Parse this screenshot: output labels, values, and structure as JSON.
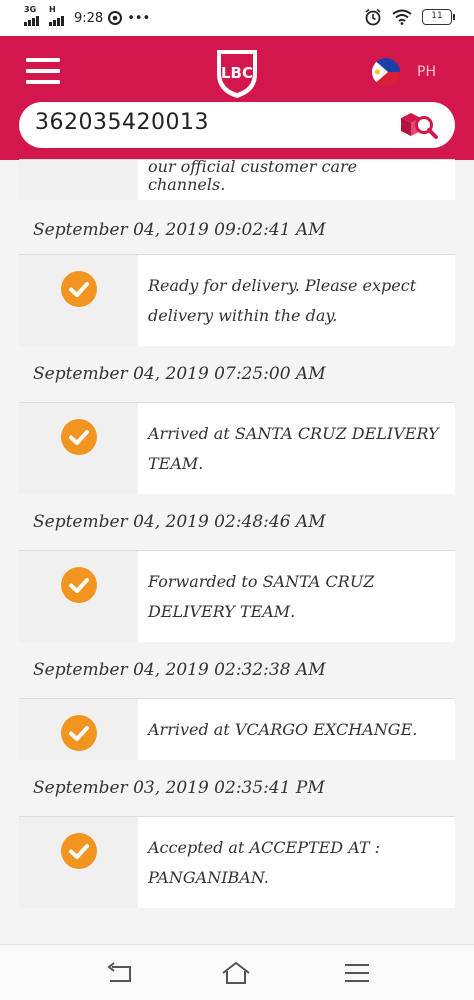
{
  "status_bar": {
    "network_top": "3G",
    "network_second": "H",
    "time": "9:28",
    "more": "•••",
    "battery": "11"
  },
  "header": {
    "logo_text": "LBC",
    "country_code": "PH",
    "brand_color": "#d3174d"
  },
  "search": {
    "value": "362035420013",
    "icon": "package-search-icon"
  },
  "timeline": {
    "partial_event_text": "our official customer care channels.",
    "entries": [
      {
        "date": "September 04, 2019 09:02:41 AM",
        "status": "Ready for delivery. Please expect delivery within the day."
      },
      {
        "date": "September 04, 2019 07:25:00 AM",
        "status": "Arrived at SANTA CRUZ DELIVERY TEAM."
      },
      {
        "date": "September 04, 2019 02:48:46 AM",
        "status": "Forwarded to SANTA CRUZ DELIVERY TEAM."
      },
      {
        "date": "September 04, 2019 02:32:38 AM",
        "status": "Arrived at VCARGO EXCHANGE."
      },
      {
        "date": "September 03, 2019 02:35:41 PM",
        "status": "Accepted at ACCEPTED AT : PANGANIBAN."
      }
    ]
  },
  "nav": {
    "back_icon": "back-icon",
    "home_icon": "home-icon",
    "menu_icon": "recents-icon"
  }
}
